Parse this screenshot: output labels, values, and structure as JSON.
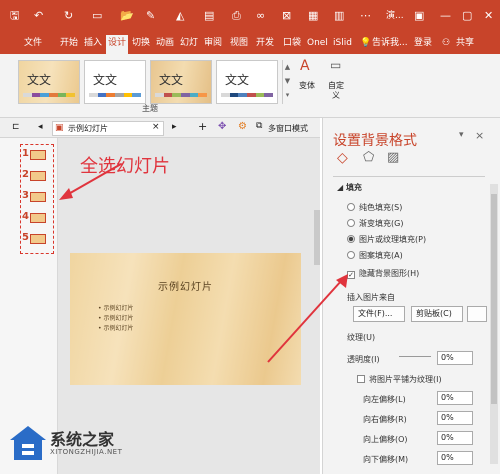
{
  "app": {
    "doc_title": "演..."
  },
  "titlebar": {
    "restore_label": "▢",
    "minimize_label": "—",
    "close_label": "✕"
  },
  "ribbon_tabs": {
    "file": "文件",
    "home": "开始",
    "insert": "插入",
    "design": "设计",
    "transitions": "切换",
    "animations": "动画",
    "slideshow": "幻灯",
    "review": "审阅",
    "view": "视图",
    "developer": "开发",
    "pocket": "口袋",
    "onenote": "Onel",
    "islide": "iSlid",
    "tellme": "告诉我...",
    "login": "登录",
    "share": "共享"
  },
  "ribbon": {
    "theme_sample": "文文",
    "group_label": "主题",
    "variant_label": "变体",
    "custom_label": "自定",
    "custom_label2": "义"
  },
  "theme_swatches": [
    [
      "#d9d9d9",
      "#8b4c9e",
      "#4aa0d8",
      "#e3793b",
      "#79b55b",
      "#f2c230"
    ],
    [
      "#d9d9d9",
      "#4472c4",
      "#ed7d31",
      "#a5a5a5",
      "#ffc000",
      "#5b9bd5"
    ],
    [
      "#d9d9d9",
      "#c0504d",
      "#9bbb59",
      "#8064a2",
      "#4bacc6",
      "#f79646"
    ],
    [
      "#d9d9d9",
      "#1f497d",
      "#4f81bd",
      "#c0504d",
      "#9bbb59",
      "#8064a2"
    ]
  ],
  "tabbar": {
    "doc_tab": "示例幻灯片",
    "multiwindow": "多窗口模式"
  },
  "slides": [
    "1",
    "2",
    "3",
    "4",
    "5"
  ],
  "annotation": "全选幻灯片",
  "slide_content": {
    "title": "示例幻灯片",
    "bullets": [
      "• 示例幻灯片",
      "• 示例幻灯片",
      "• 示例幻灯片"
    ]
  },
  "pane": {
    "title": "设置背景格式",
    "section": "填充",
    "fill_options": [
      "纯色填充(S)",
      "渐变填充(G)",
      "图片或纹理填充(P)",
      "图案填充(A)"
    ],
    "selected_index": 2,
    "hide_bg": "隐藏背景图形(H)",
    "hide_bg_checked": true,
    "insert_from": "插入图片来自",
    "file_btn": "文件(F)...",
    "clipboard_btn": "剪贴板(C)",
    "texture": "纹理(U)",
    "transparency": "透明度(I)",
    "transparency_val": "0%",
    "tile": "将图片平铺为纹理(I)",
    "offsets": [
      {
        "label": "向左偏移(L)",
        "value": "0%"
      },
      {
        "label": "向右偏移(R)",
        "value": "0%"
      },
      {
        "label": "向上偏移(O)",
        "value": "0%"
      },
      {
        "label": "向下偏移(M)",
        "value": "0%"
      }
    ]
  },
  "watermark": {
    "name": "系统之家",
    "url": "XITONGZHIJIA.NET"
  },
  "colors": {
    "accent": "#c8442a",
    "annotation_red": "#e0343d"
  }
}
